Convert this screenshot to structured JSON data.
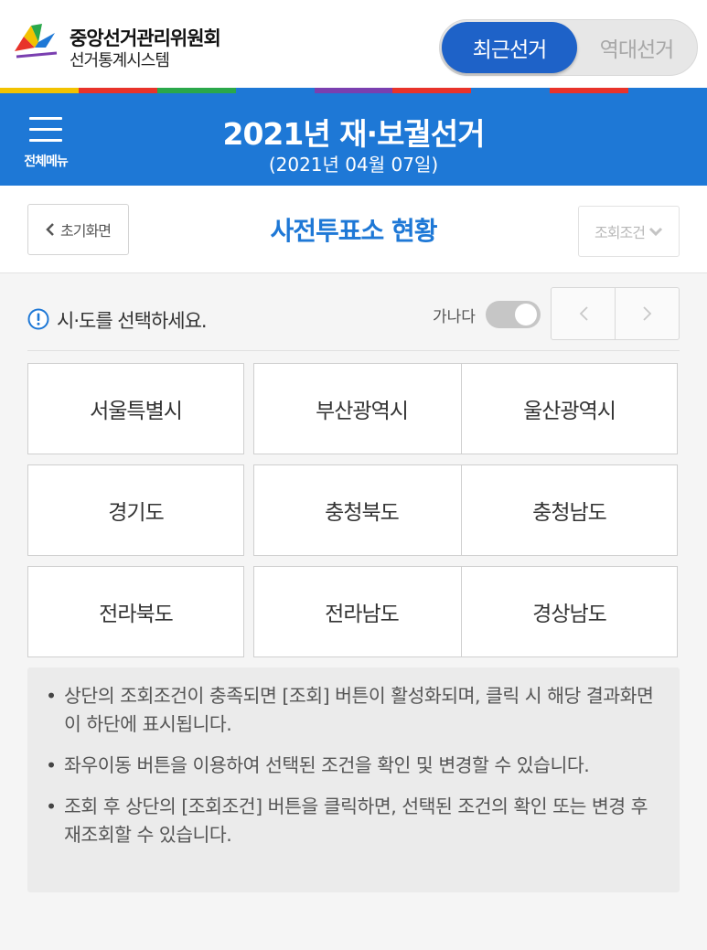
{
  "header": {
    "org_name": "중앙선거관리위원회",
    "system_name": "선거통계시스템",
    "toggle_recent": "최근선거",
    "toggle_history": "역대선거"
  },
  "title_bar": {
    "menu_label": "전체메뉴",
    "election_title": "2021년 재·보궐선거",
    "election_date": "(2021년 04월 07일)"
  },
  "sub_header": {
    "home_label": "초기화면",
    "page_title": "사전투표소 현황",
    "query_label": "조회조건"
  },
  "notice": {
    "text": "시·도를 선택하세요.",
    "sort_label": "가나다"
  },
  "regions": [
    "서울특별시",
    "부산광역시",
    "울산광역시",
    "경기도",
    "충청북도",
    "충청남도",
    "전라북도",
    "전라남도",
    "경상남도"
  ],
  "help": [
    "상단의 조회조건이 충족되면 [조회] 버튼이 활성화되며, 클릭 시 해당 결과화면이 하단에 표시됩니다.",
    "좌우이동 버튼을 이용하여 선택된 조건을 확인 및 변경할 수 있습니다.",
    "조회 후 상단의 [조회조건] 버튼을 클릭하면, 선택된 조건의 확인 또는 변경 후 재조회할 수 있습니다."
  ],
  "colors": {
    "primary": "#1e78d6",
    "toggle_active": "#1e62c8",
    "strip": [
      "#f2c200",
      "#e8332a",
      "#2aa84a",
      "#1e78d6",
      "#7a3fb0",
      "#e8332a",
      "#1e78d6",
      "#e8332a",
      "#1e78d6"
    ]
  },
  "icons": {
    "logo": "nec-logo-icon",
    "menu": "hamburger-menu-icon",
    "back": "chevron-left-icon",
    "dropdown": "chevron-down-icon",
    "info": "info-circle-icon",
    "prev": "chevron-left-icon",
    "next": "chevron-right-icon"
  }
}
